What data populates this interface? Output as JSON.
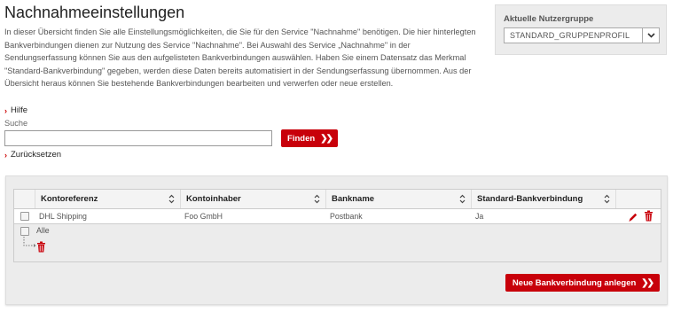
{
  "page": {
    "title": "Nachnahmeeinstellungen",
    "intro": "In dieser Übersicht finden Sie alle Einstellungsmöglichkeiten, die Sie für den Service \"Nachnahme\" benötigen. Die hier hinterlegten Bankverbindungen dienen zur Nutzung des Service \"Nachnahme\". Bei Auswahl des Service „Nachnahme\" in der Sendungserfassung können Sie aus den aufgelisteten Bankverbindungen auswählen. Haben Sie einem Datensatz das Merkmal \"Standard-Bankverbindung\" gegeben, werden diese Daten bereits automatisiert in der Sendungserfassung übernommen. Aus der Übersicht heraus können Sie bestehende Bankverbindungen bearbeiten und verwerfen oder neue erstellen."
  },
  "links": {
    "help": "Hilfe",
    "reset": "Zurücksetzen"
  },
  "search": {
    "label": "Suche",
    "value": "",
    "button": "Finden"
  },
  "user_group": {
    "label": "Aktuelle Nutzergruppe",
    "selected": "STANDARD_GRUPPENPROFIL"
  },
  "table": {
    "columns": [
      "Kontoreferenz",
      "Kontoinhaber",
      "Bankname",
      "Standard-Bankverbindung"
    ],
    "rows": [
      {
        "kontoreferenz": "DHL Shipping",
        "kontoinhaber": "Foo GmbH",
        "bankname": "Postbank",
        "standard": "Ja"
      }
    ],
    "select_all": "Alle"
  },
  "new_button": "Neue Bankverbindung anlegen",
  "colors": {
    "accent": "#c8000a",
    "panel": "#ececec"
  },
  "icons": [
    "chevron-right-icon",
    "double-chevron-right-icon",
    "sort-icon",
    "edit-pencil-icon",
    "trash-icon",
    "dropdown-arrow-icon",
    "tree-branch-icon"
  ]
}
